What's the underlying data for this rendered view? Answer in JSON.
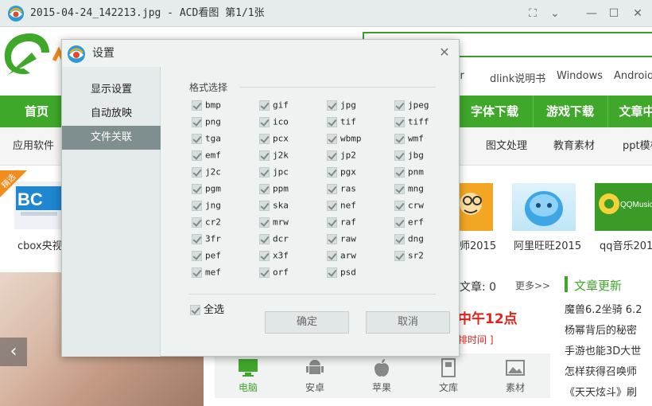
{
  "window": {
    "title": "2015-04-24_142213.jpg - ACD看图 第1/1张",
    "controls": {
      "fullscreen": "⛶",
      "dropdown": "⌄",
      "minimize": "—",
      "maximize": "☐",
      "close": "✕"
    }
  },
  "page": {
    "toplinks": [
      "rter",
      "dlink说明书",
      "Windows",
      "Android"
    ],
    "nav": [
      "首页",
      "字体下载",
      "游戏下载",
      "文章中"
    ],
    "subnav": [
      "应用软件",
      "图文处理",
      "教育素材",
      "ppt模板"
    ],
    "badge": "精选",
    "tiles": [
      {
        "label": "cbox央视",
        "logo": "BC"
      },
      {
        "label": "师2015"
      },
      {
        "label": "阿里旺旺2015"
      },
      {
        "label": "qq音乐2015",
        "logo": "QQMusic"
      }
    ],
    "articles_count": "文章: 0",
    "more": "更多>>",
    "headline": "中午12点",
    "headline_sub": "排时间 ]",
    "news_title": "文章更新",
    "news": [
      "魔兽6.2坐骑 6.2",
      "杨幂背后的秘密",
      "手游也能3D大世",
      "怎样获得召唤师",
      "《天天炫斗》刷"
    ],
    "bottom_tabs": [
      {
        "label": "电脑",
        "icon": "monitor-icon",
        "active": true
      },
      {
        "label": "安卓",
        "icon": "android-icon"
      },
      {
        "label": "苹果",
        "icon": "apple-icon"
      },
      {
        "label": "文库",
        "icon": "document-icon"
      },
      {
        "label": "素材",
        "icon": "image-icon"
      }
    ],
    "prev_arrow": "‹",
    "colors": {
      "nav_green": "#3fa82a",
      "headline_red": "#e2231a"
    }
  },
  "dialog": {
    "title": "设置",
    "close": "✕",
    "sidebar": [
      {
        "label": "显示设置",
        "active": false
      },
      {
        "label": "自动放映",
        "active": false
      },
      {
        "label": "文件关联",
        "active": true
      }
    ],
    "group_label": "格式选择",
    "formats": [
      "bmp",
      "gif",
      "jpg",
      "jpeg",
      "png",
      "ico",
      "tif",
      "tiff",
      "tga",
      "pcx",
      "wbmp",
      "wmf",
      "emf",
      "j2k",
      "jp2",
      "jbg",
      "j2c",
      "jpc",
      "pgx",
      "pnm",
      "pgm",
      "ppm",
      "ras",
      "mng",
      "jng",
      "ska",
      "nef",
      "crw",
      "cr2",
      "mrw",
      "raf",
      "erf",
      "3fr",
      "dcr",
      "raw",
      "dng",
      "pef",
      "x3f",
      "arw",
      "sr2",
      "mef",
      "orf",
      "psd"
    ],
    "select_all": "全选",
    "ok": "确定",
    "cancel": "取消"
  }
}
